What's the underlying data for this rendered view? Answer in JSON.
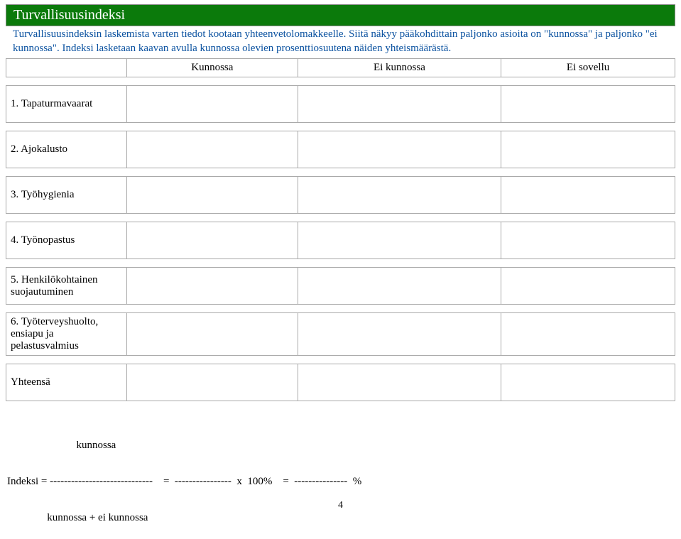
{
  "header": {
    "title": "Turvallisuusindeksi"
  },
  "intro": {
    "text": "Turvallisuusindeksin laskemista varten tiedot kootaan yhteenvetolomakkeelle. Siitä näkyy pääkohdittain paljonko asioita on \"kunnossa\" ja paljonko \"ei kunnossa\". Indeksi lasketaan kaavan avulla kunnossa olevien prosenttiosuutena näiden yhteismäärästä."
  },
  "table": {
    "columns": [
      "Kunnossa",
      "Ei kunnossa",
      "Ei sovellu"
    ],
    "rows": [
      {
        "label": "1. Tapaturmavaarat"
      },
      {
        "label": "2. Ajokalusto"
      },
      {
        "label": "3. Työhygienia"
      },
      {
        "label": "4. Työnopastus"
      },
      {
        "label": "5. Henkilökohtainen suojautuminen"
      },
      {
        "label": "6. Työterveyshuolto, ensiapu ja pelastusvalmius"
      },
      {
        "label": "Yhteensä"
      }
    ]
  },
  "formula": {
    "line1": "                          kunnossa",
    "line2": "Indeksi = -----------------------------    =  ----------------  x  100%    =  ---------------  %",
    "line3": "               kunnossa + ei kunnossa"
  },
  "page_number": "4"
}
